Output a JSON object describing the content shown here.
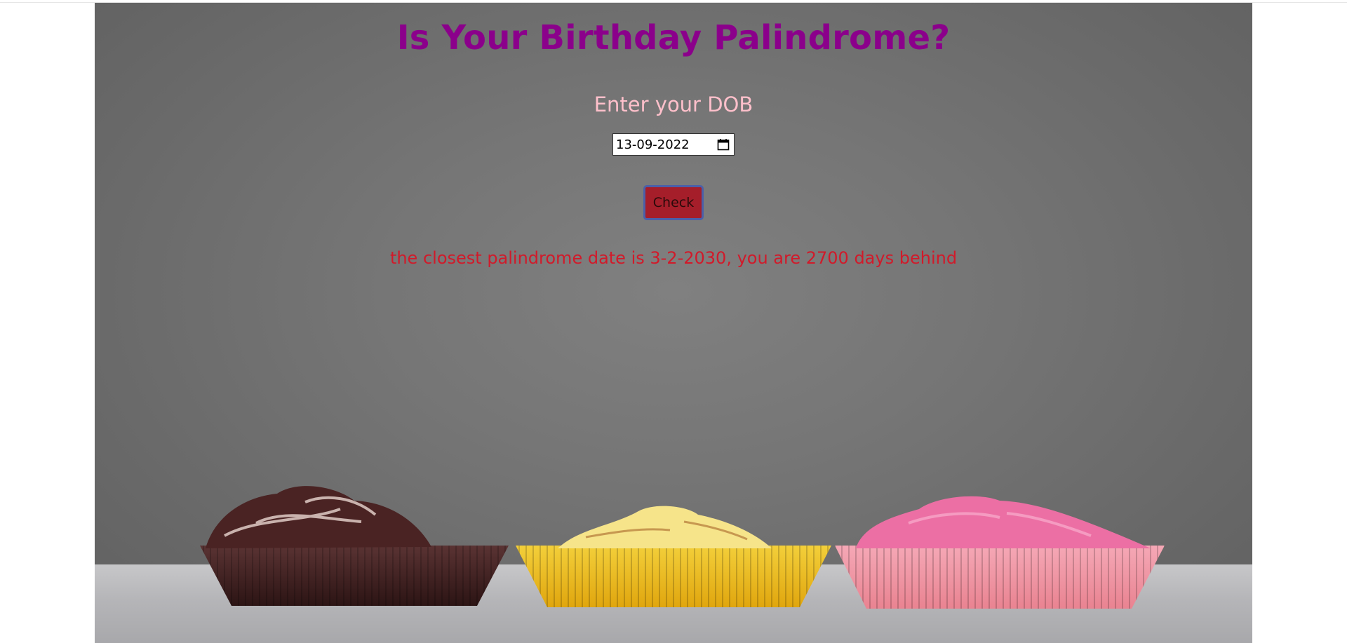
{
  "page": {
    "title": "Is Your Birthday Palindrome?",
    "dob_label": "Enter your DOB",
    "dob_value": "13-09-2022",
    "check_button": "Check",
    "result_message": "the closest palindrome date is 3-2-2030, you are 2700 days behind"
  },
  "icons": {
    "date_picker": "calendar-icon"
  },
  "colors": {
    "title": "#8b008b",
    "label": "#ffc0cb",
    "button_bg": "#a51e2a",
    "button_border": "#4b5fa8",
    "result": "#d11a2a"
  }
}
